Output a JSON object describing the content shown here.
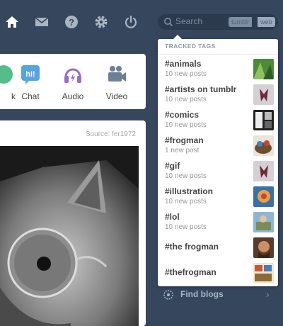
{
  "nav": {
    "icons": [
      "home-icon",
      "mail-icon",
      "help-icon",
      "gear-icon",
      "power-icon"
    ]
  },
  "search": {
    "placeholder": "Search",
    "scope_tumblr": "tumblr",
    "scope_web": "web"
  },
  "post_types": [
    {
      "label": "Link",
      "icon": "link-icon"
    },
    {
      "label": "Chat",
      "icon": "chat-icon"
    },
    {
      "label": "Audio",
      "icon": "audio-icon"
    },
    {
      "label": "Video",
      "icon": "video-icon"
    }
  ],
  "post": {
    "source": "Source: fer1972"
  },
  "tracked_tags": {
    "header": "TRACKED TAGS",
    "items": [
      {
        "name": "#animals",
        "count": "10 new posts"
      },
      {
        "name": "#artists on tumblr",
        "count": "10 new posts"
      },
      {
        "name": "#comics",
        "count": "10 new posts"
      },
      {
        "name": "#frogman",
        "count": "1 new post"
      },
      {
        "name": "#gif",
        "count": "10 new posts"
      },
      {
        "name": "#illustration",
        "count": "10 new posts"
      },
      {
        "name": "#lol",
        "count": "10 new posts"
      },
      {
        "name": "#the frogman",
        "count": ""
      },
      {
        "name": "#thefrogman",
        "count": ""
      }
    ]
  },
  "find_blogs": {
    "label": "Find blogs"
  },
  "colors": {
    "background": "#36465d",
    "panel": "#ffffff",
    "accent_purple": "#9b6ac7",
    "accent_teal": "#56bc8a",
    "chat_blue": "#56a4e0"
  }
}
